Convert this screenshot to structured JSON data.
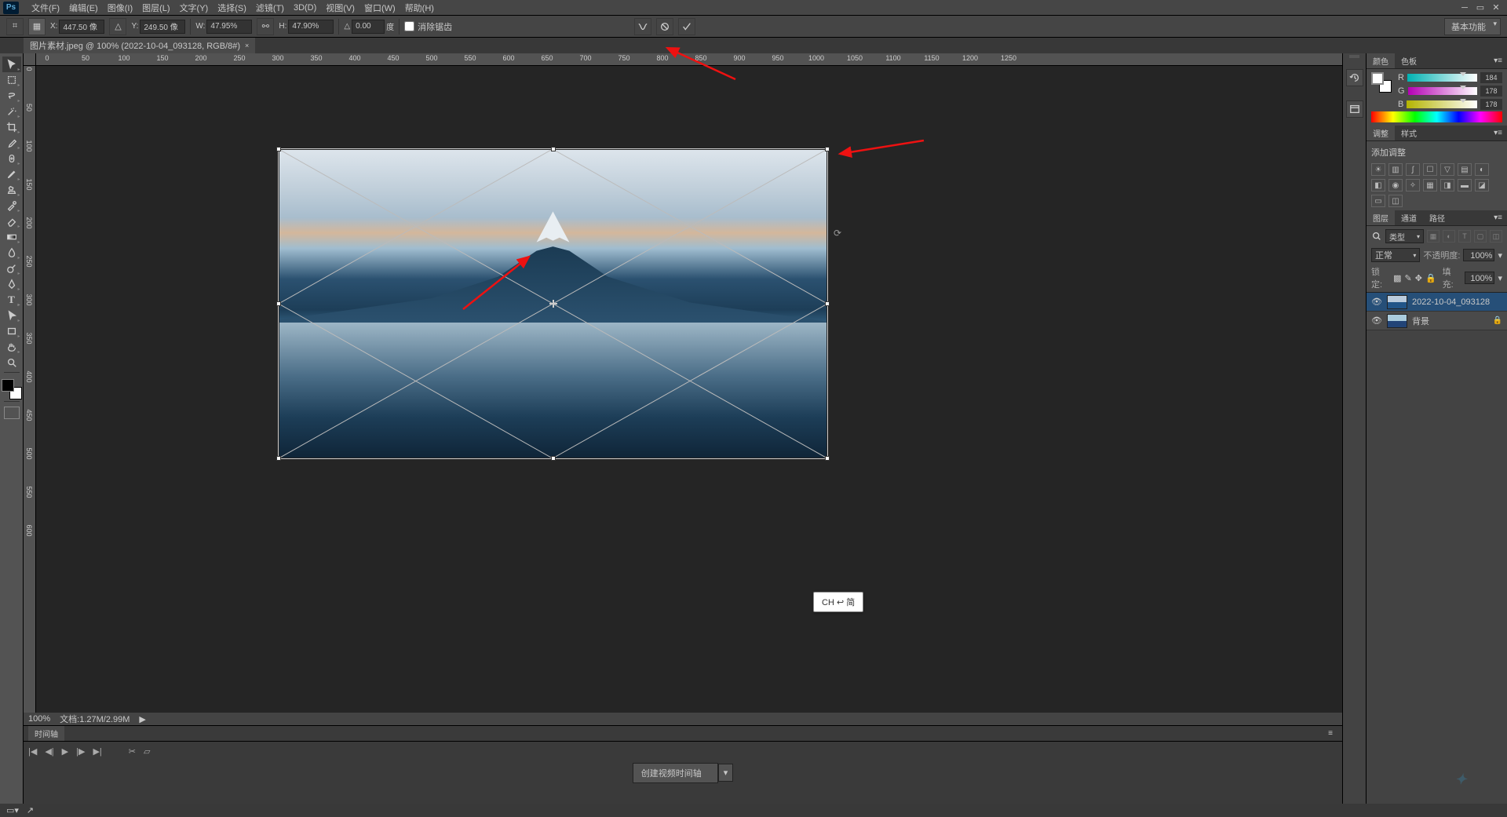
{
  "menubar": {
    "logo": "Ps",
    "items": [
      "文件(F)",
      "编辑(E)",
      "图像(I)",
      "图层(L)",
      "文字(Y)",
      "选择(S)",
      "滤镜(T)",
      "3D(D)",
      "视图(V)",
      "窗口(W)",
      "帮助(H)"
    ]
  },
  "options": {
    "x_label": "X:",
    "x_value": "447.50 像",
    "y_label": "Y:",
    "y_value": "249.50 像",
    "w_label": "W:",
    "w_value": "47.95%",
    "h_label": "H:",
    "h_value": "47.90%",
    "angle_label": "△",
    "angle_value": "0.00",
    "angle_unit": "度",
    "anti_alias": "消除锯齿",
    "workspace": "基本功能"
  },
  "doc_tab": {
    "title": "图片素材.jpeg @ 100% (2022-10-04_093128, RGB/8#)"
  },
  "ruler": {
    "h_labels": [
      "0",
      "50",
      "100",
      "150",
      "200",
      "250",
      "300",
      "350",
      "400",
      "450",
      "500",
      "550",
      "600",
      "650",
      "700",
      "750",
      "800",
      "850",
      "900",
      "950",
      "1000",
      "1050",
      "1100",
      "1150",
      "1200",
      "1250"
    ],
    "v_labels": [
      "0",
      "50",
      "1\n0\n0",
      "1\n5\n0",
      "2\n0\n0",
      "2\n5\n0",
      "3\n0\n0",
      "3\n5\n0",
      "4\n0\n0",
      "4\n5\n0",
      "5\n0\n0",
      "5\n5\n0",
      "6\n0\n0"
    ]
  },
  "status": {
    "zoom": "100%",
    "doc_size": "文档:1.27M/2.99M"
  },
  "timeline": {
    "title": "时间轴",
    "create": "创建视频时间轴"
  },
  "color_panel": {
    "tabs": [
      "颜色",
      "色板"
    ],
    "r": "R",
    "g": "G",
    "b": "B",
    "r_val": "184",
    "g_val": "178",
    "b_val": "178"
  },
  "adjust_panel": {
    "tabs": [
      "调整",
      "样式"
    ],
    "title": "添加调整"
  },
  "layers_panel": {
    "tabs": [
      "图层",
      "通道",
      "路径"
    ],
    "kind": "类型",
    "blend": "正常",
    "opacity_label": "不透明度:",
    "opacity": "100%",
    "lock_label": "锁定:",
    "fill_label": "填充:",
    "fill": "100%",
    "layers": [
      {
        "name": "2022-10-04_093128",
        "selected": true,
        "locked": false
      },
      {
        "name": "背景",
        "selected": false,
        "locked": true
      }
    ]
  },
  "ime": "CH ↩ 简"
}
